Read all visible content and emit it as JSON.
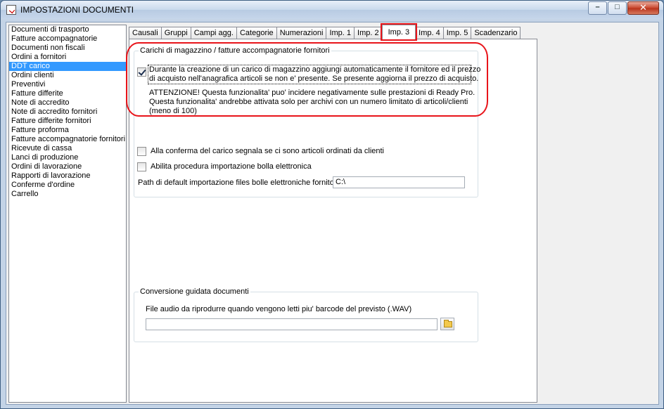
{
  "window": {
    "title": "IMPOSTAZIONI DOCUMENTI",
    "buttons": {
      "minimize": "–",
      "maximize": "□",
      "close": "✕"
    }
  },
  "doc_list": [
    "Documenti di trasporto",
    "Fatture accompagnatorie",
    "Documenti non fiscali",
    "Ordini a fornitori",
    "DDT carico",
    "Ordini clienti",
    "Preventivi",
    "Fatture differite",
    "Note di accredito",
    "Note di accredito fornitori",
    "Fatture differite fornitori",
    "Fatture proforma",
    "Fatture accompagnatorie fornitori",
    "Ricevute di cassa",
    "Lanci di produzione",
    "Ordini di lavorazione",
    "Rapporti di lavorazione",
    "Conferme d'ordine",
    "Carrello"
  ],
  "selected_doc": "DDT carico",
  "tabs": [
    "Causali",
    "Gruppi",
    "Campi agg.",
    "Categorie",
    "Numerazioni",
    "Imp. 1",
    "Imp. 2",
    "Imp. 3",
    "Imp. 4",
    "Imp. 5",
    "Scadenzario"
  ],
  "active_tab": "Imp. 3",
  "carichi": {
    "title": "Carichi di magazzino / fatture accompagnatorie fornitori",
    "auto_supplier_checked": true,
    "auto_supplier_line1": "Durante la creazione di un carico di magazzino aggiungi automaticamente il fornitore ed il prezzo",
    "auto_supplier_line2": "di acquisto nell'anagrafica articoli se non e' presente. Se presente aggiorna il prezzo di acquisto.",
    "warning_line1": "ATTENZIONE! Questa funzionalita' puo' incidere negativamente sulle prestazioni di Ready Pro.",
    "warning_line2": "Questa funzionalita' andrebbe attivata solo per archivi con un numero limitato di articoli/clienti",
    "warning_line3": "(meno di 100)",
    "signal_ordered_label": "Alla conferma del carico segnala se ci sono articoli ordinati da clienti",
    "signal_ordered_checked": false,
    "import_bolla_label": "Abilita procedura importazione bolla elettronica",
    "import_bolla_checked": false,
    "path_label": "Path di default importazione files bolle elettroniche fornitori",
    "path_value": "C:\\"
  },
  "conversione": {
    "title": "Conversione guidata documenti",
    "audio_label": "File audio da riprodurre quando vengono letti piu' barcode del previsto  (.WAV)",
    "audio_value": ""
  }
}
